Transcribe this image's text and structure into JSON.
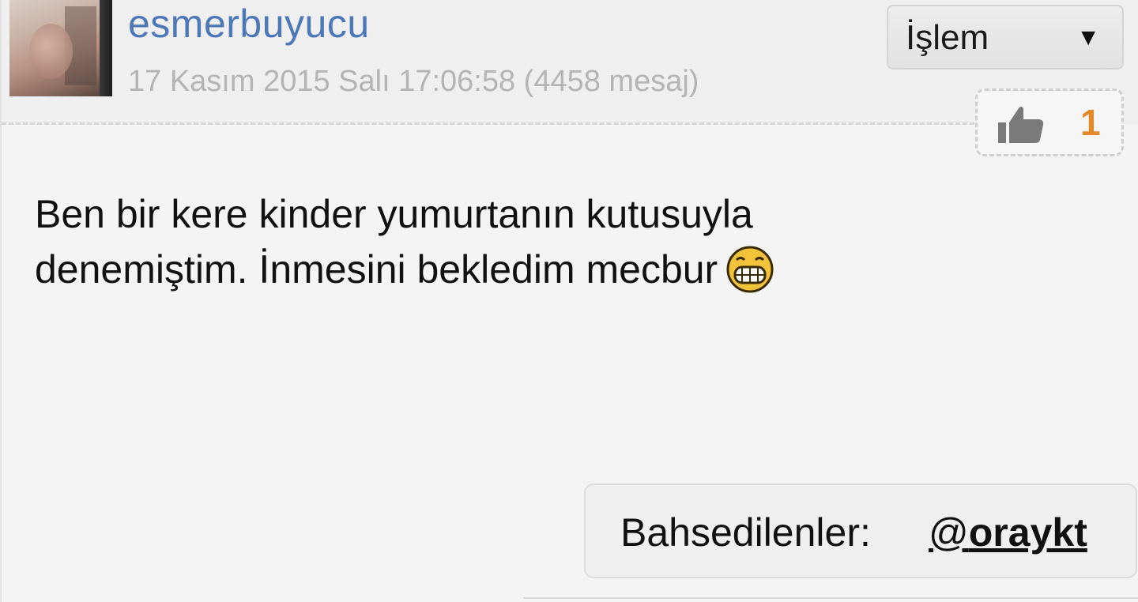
{
  "post": {
    "author": {
      "username": "esmerbuyucu",
      "meta": "17 Kasım 2015 Salı 17:06:58 (4458 mesaj)"
    },
    "actions": {
      "label": "İşlem",
      "caret": "▼"
    },
    "likes": {
      "icon": "thumbs-up-icon",
      "count": "1",
      "count_color": "#e58a2b"
    },
    "content": {
      "line1": "Ben bir kere kinder yumurtanın kutusuyla",
      "line2": "denemiştim. İnmesini bekledim mecbur",
      "emoji": "grinning-face-icon"
    },
    "mentions": {
      "label": "Bahsedilenler:",
      "at": "@",
      "handle": "oraykt"
    },
    "colors": {
      "username": "#4d78b8",
      "meta": "#b4b4b4",
      "background": "#f4f4f4"
    }
  }
}
